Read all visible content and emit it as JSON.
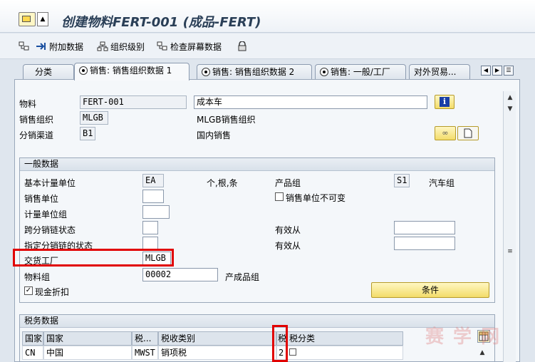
{
  "window": {
    "title": "创建物料FERT-001 (成品-FERT)",
    "menu_arrow": "▲"
  },
  "toolbar": {
    "additional_data": "附加数据",
    "org_levels": "组织级别",
    "check_screen_data": "检查屏幕数据"
  },
  "tabs": [
    {
      "label": "分类"
    },
    {
      "label": "销售: 销售组织数据 1"
    },
    {
      "label": "销售: 销售组织数据 2"
    },
    {
      "label": "销售: 一般/工厂"
    },
    {
      "label": "对外贸易..."
    }
  ],
  "header": {
    "material_label": "物料",
    "material_value": "FERT-001",
    "material_desc": "成本车",
    "sales_org_label": "销售组织",
    "sales_org_value": "MLGB",
    "sales_org_desc": "MLGB销售组织",
    "dist_channel_label": "分销渠道",
    "dist_channel_value": "B1",
    "dist_channel_desc": "国内销售",
    "info_icon_glyph": "i"
  },
  "general": {
    "title": "一般数据",
    "base_uom_label": "基本计量单位",
    "base_uom_value": "EA",
    "base_uom_desc": "个,根,条",
    "division_label": "产品组",
    "division_value": "S1",
    "division_desc": "汽车组",
    "sales_unit_label": "销售单位",
    "sales_unit_value": "",
    "sales_unit_fixed_label": "销售单位不可变",
    "uom_group_label": "计量单位组",
    "uom_group_value": "",
    "x_dchain_status_label": "跨分销链状态",
    "x_dchain_status_value": "",
    "valid_from_label_1": "有效从",
    "valid_from_value_1": "",
    "dchain_status_label": "指定分销链的状态",
    "dchain_status_value": "",
    "valid_from_label_2": "有效从",
    "valid_from_value_2": "",
    "delivery_plant_label": "交货工厂",
    "delivery_plant_value": "MLGB",
    "material_group_label": "物料组",
    "material_group_value": "00002",
    "material_group_desc": "产成品组",
    "cash_discount_label": "现金折扣",
    "cash_discount_checked": "✓",
    "conditions_button": "条件"
  },
  "tax": {
    "title": "税务数据",
    "columns": [
      "国家",
      "国家",
      "税...",
      "税收类别",
      "税",
      "税分类"
    ],
    "rows": [
      {
        "country_code": "CN",
        "country": "中国",
        "tax_cat": "MWST",
        "tax_cat_desc": "销项税",
        "tax_class": "2"
      }
    ]
  },
  "watermark": "赛 学 网",
  "colors": {
    "highlight": "#e10000",
    "button_yellow": "#f3dc6a"
  }
}
